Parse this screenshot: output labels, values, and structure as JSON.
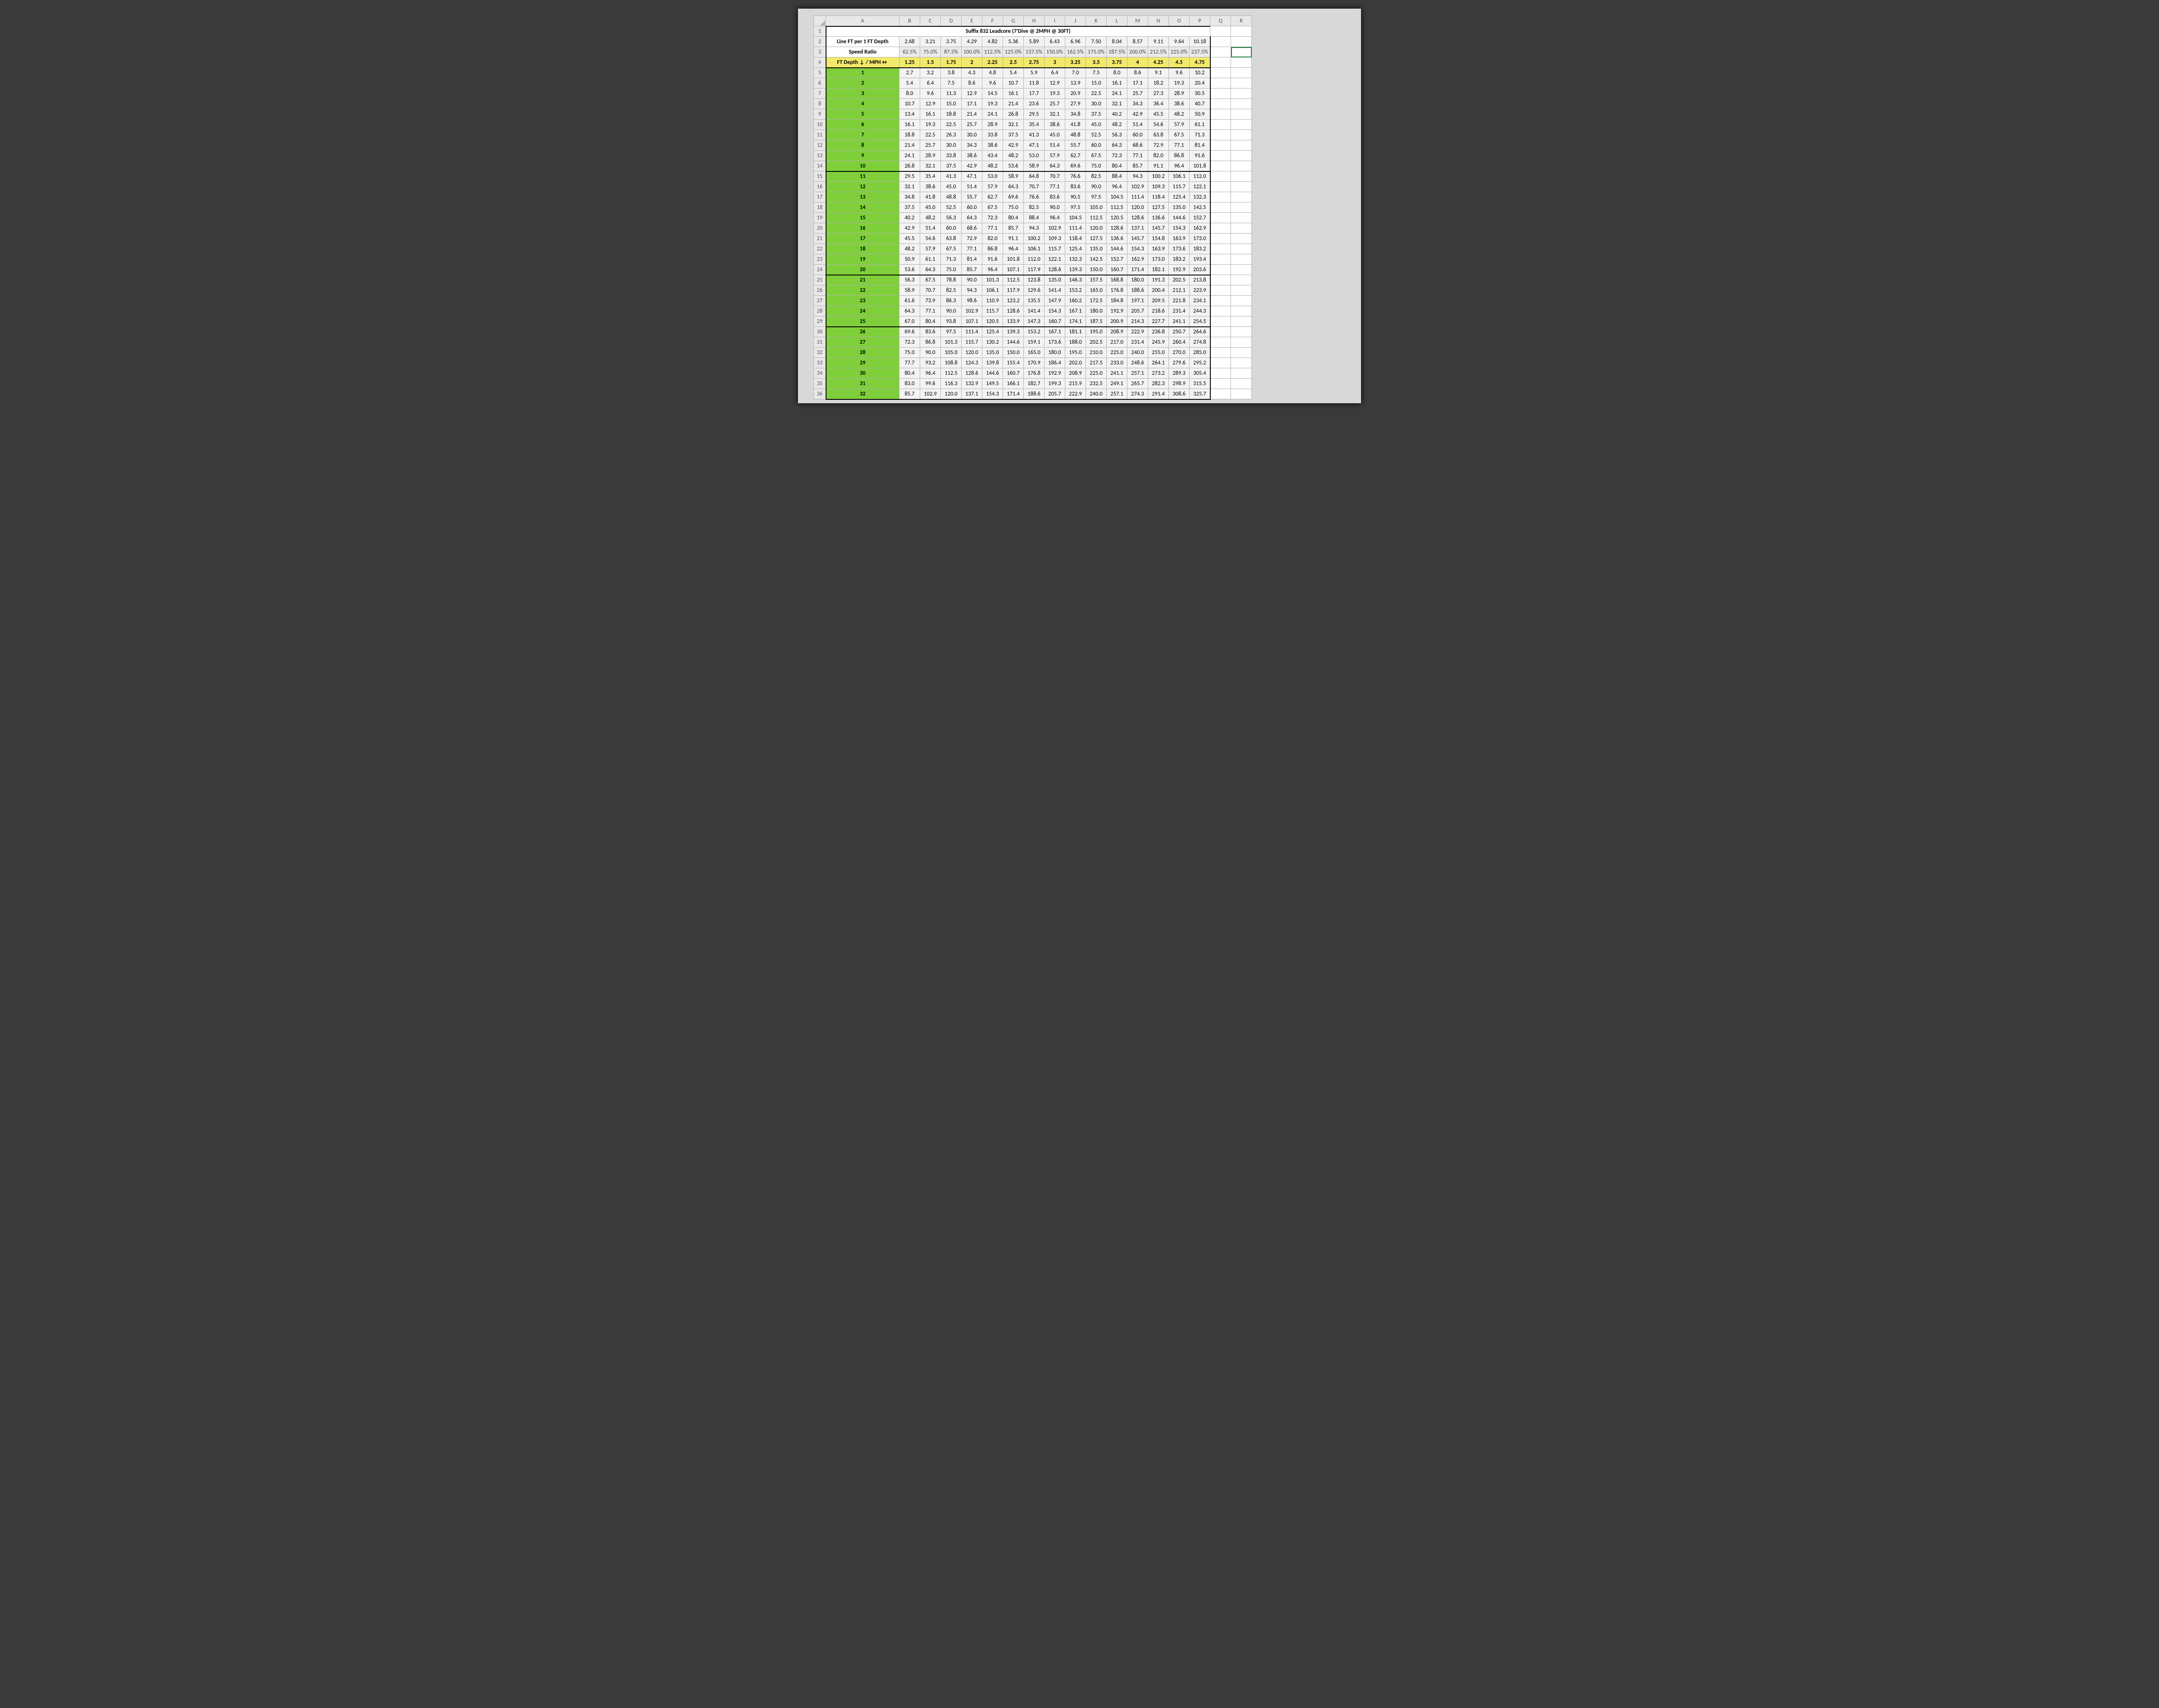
{
  "chart_data": {
    "type": "table",
    "title": "Suffix 832 Leadcore (7'Dive @ 2MPH @ 30FT)",
    "header_labels": {
      "line_ft_per_depth": "Line FT per 1 FT Depth",
      "speed_ratio": "Speed Ratio",
      "depth_mph": "FT Depth ↓ / MPH↔"
    },
    "columns_letters": [
      "A",
      "B",
      "C",
      "D",
      "E",
      "F",
      "G",
      "H",
      "I",
      "J",
      "K",
      "L",
      "M",
      "N",
      "O",
      "P",
      "Q",
      "R"
    ],
    "row_numbers": [
      1,
      2,
      3,
      4,
      5,
      6,
      7,
      8,
      9,
      10,
      11,
      12,
      13,
      14,
      15,
      16,
      17,
      18,
      19,
      20,
      21,
      22,
      23,
      24,
      25,
      26,
      27,
      28,
      29,
      30,
      31,
      32,
      33,
      34,
      35,
      36
    ],
    "line_ft": [
      "2.68",
      "3.21",
      "3.75",
      "4.29",
      "4.82",
      "5.36",
      "5.89",
      "6.43",
      "6.96",
      "7.50",
      "8.04",
      "8.57",
      "9.11",
      "9.64",
      "10.18"
    ],
    "speed_ratio": [
      "62.5%",
      "75.0%",
      "87.5%",
      "100.0%",
      "112.5%",
      "125.0%",
      "137.5%",
      "150.0%",
      "162.5%",
      "175.0%",
      "187.5%",
      "200.0%",
      "212.5%",
      "225.0%",
      "237.5%"
    ],
    "mph": [
      "1.25",
      "1.5",
      "1.75",
      "2",
      "2.25",
      "2.5",
      "2.75",
      "3",
      "3.25",
      "3.5",
      "3.75",
      "4",
      "4.25",
      "4.5",
      "4.75"
    ],
    "depth_labels": [
      "1",
      "2",
      "3",
      "4",
      "5",
      "6",
      "7",
      "8",
      "9",
      "10",
      "11",
      "12",
      "13",
      "14",
      "15",
      "16",
      "17",
      "18",
      "19",
      "20",
      "21",
      "22",
      "23",
      "24",
      "25",
      "26",
      "27",
      "28",
      "29",
      "30",
      "31",
      "32"
    ],
    "values": [
      [
        "2.7",
        "3.2",
        "3.8",
        "4.3",
        "4.8",
        "5.4",
        "5.9",
        "6.4",
        "7.0",
        "7.5",
        "8.0",
        "8.6",
        "9.1",
        "9.6",
        "10.2"
      ],
      [
        "5.4",
        "6.4",
        "7.5",
        "8.6",
        "9.6",
        "10.7",
        "11.8",
        "12.9",
        "13.9",
        "15.0",
        "16.1",
        "17.1",
        "18.2",
        "19.3",
        "20.4"
      ],
      [
        "8.0",
        "9.6",
        "11.3",
        "12.9",
        "14.5",
        "16.1",
        "17.7",
        "19.3",
        "20.9",
        "22.5",
        "24.1",
        "25.7",
        "27.3",
        "28.9",
        "30.5"
      ],
      [
        "10.7",
        "12.9",
        "15.0",
        "17.1",
        "19.3",
        "21.4",
        "23.6",
        "25.7",
        "27.9",
        "30.0",
        "32.1",
        "34.3",
        "36.4",
        "38.6",
        "40.7"
      ],
      [
        "13.4",
        "16.1",
        "18.8",
        "21.4",
        "24.1",
        "26.8",
        "29.5",
        "32.1",
        "34.8",
        "37.5",
        "40.2",
        "42.9",
        "45.5",
        "48.2",
        "50.9"
      ],
      [
        "16.1",
        "19.3",
        "22.5",
        "25.7",
        "28.9",
        "32.1",
        "35.4",
        "38.6",
        "41.8",
        "45.0",
        "48.2",
        "51.4",
        "54.6",
        "57.9",
        "61.1"
      ],
      [
        "18.8",
        "22.5",
        "26.3",
        "30.0",
        "33.8",
        "37.5",
        "41.3",
        "45.0",
        "48.8",
        "52.5",
        "56.3",
        "60.0",
        "63.8",
        "67.5",
        "71.3"
      ],
      [
        "21.4",
        "25.7",
        "30.0",
        "34.3",
        "38.6",
        "42.9",
        "47.1",
        "51.4",
        "55.7",
        "60.0",
        "64.3",
        "68.6",
        "72.9",
        "77.1",
        "81.4"
      ],
      [
        "24.1",
        "28.9",
        "33.8",
        "38.6",
        "43.4",
        "48.2",
        "53.0",
        "57.9",
        "62.7",
        "67.5",
        "72.3",
        "77.1",
        "82.0",
        "86.8",
        "91.6"
      ],
      [
        "26.8",
        "32.1",
        "37.5",
        "42.9",
        "48.2",
        "53.6",
        "58.9",
        "64.3",
        "69.6",
        "75.0",
        "80.4",
        "85.7",
        "91.1",
        "96.4",
        "101.8"
      ],
      [
        "29.5",
        "35.4",
        "41.3",
        "47.1",
        "53.0",
        "58.9",
        "64.8",
        "70.7",
        "76.6",
        "82.5",
        "88.4",
        "94.3",
        "100.2",
        "106.1",
        "112.0"
      ],
      [
        "32.1",
        "38.6",
        "45.0",
        "51.4",
        "57.9",
        "64.3",
        "70.7",
        "77.1",
        "83.6",
        "90.0",
        "96.4",
        "102.9",
        "109.3",
        "115.7",
        "122.1"
      ],
      [
        "34.8",
        "41.8",
        "48.8",
        "55.7",
        "62.7",
        "69.6",
        "76.6",
        "83.6",
        "90.5",
        "97.5",
        "104.5",
        "111.4",
        "118.4",
        "125.4",
        "132.3"
      ],
      [
        "37.5",
        "45.0",
        "52.5",
        "60.0",
        "67.5",
        "75.0",
        "82.5",
        "90.0",
        "97.5",
        "105.0",
        "112.5",
        "120.0",
        "127.5",
        "135.0",
        "142.5"
      ],
      [
        "40.2",
        "48.2",
        "56.3",
        "64.3",
        "72.3",
        "80.4",
        "88.4",
        "96.4",
        "104.5",
        "112.5",
        "120.5",
        "128.6",
        "136.6",
        "144.6",
        "152.7"
      ],
      [
        "42.9",
        "51.4",
        "60.0",
        "68.6",
        "77.1",
        "85.7",
        "94.3",
        "102.9",
        "111.4",
        "120.0",
        "128.6",
        "137.1",
        "145.7",
        "154.3",
        "162.9"
      ],
      [
        "45.5",
        "54.6",
        "63.8",
        "72.9",
        "82.0",
        "91.1",
        "100.2",
        "109.3",
        "118.4",
        "127.5",
        "136.6",
        "145.7",
        "154.8",
        "163.9",
        "173.0"
      ],
      [
        "48.2",
        "57.9",
        "67.5",
        "77.1",
        "86.8",
        "96.4",
        "106.1",
        "115.7",
        "125.4",
        "135.0",
        "144.6",
        "154.3",
        "163.9",
        "173.6",
        "183.2"
      ],
      [
        "50.9",
        "61.1",
        "71.3",
        "81.4",
        "91.6",
        "101.8",
        "112.0",
        "122.1",
        "132.3",
        "142.5",
        "152.7",
        "162.9",
        "173.0",
        "183.2",
        "193.4"
      ],
      [
        "53.6",
        "64.3",
        "75.0",
        "85.7",
        "96.4",
        "107.1",
        "117.9",
        "128.6",
        "139.3",
        "150.0",
        "160.7",
        "171.4",
        "182.1",
        "192.9",
        "203.6"
      ],
      [
        "56.3",
        "67.5",
        "78.8",
        "90.0",
        "101.3",
        "112.5",
        "123.8",
        "135.0",
        "146.3",
        "157.5",
        "168.8",
        "180.0",
        "191.3",
        "202.5",
        "213.8"
      ],
      [
        "58.9",
        "70.7",
        "82.5",
        "94.3",
        "106.1",
        "117.9",
        "129.6",
        "141.4",
        "153.2",
        "165.0",
        "176.8",
        "188.6",
        "200.4",
        "212.1",
        "223.9"
      ],
      [
        "61.6",
        "73.9",
        "86.3",
        "98.6",
        "110.9",
        "123.2",
        "135.5",
        "147.9",
        "160.2",
        "172.5",
        "184.8",
        "197.1",
        "209.5",
        "221.8",
        "234.1"
      ],
      [
        "64.3",
        "77.1",
        "90.0",
        "102.9",
        "115.7",
        "128.6",
        "141.4",
        "154.3",
        "167.1",
        "180.0",
        "192.9",
        "205.7",
        "218.6",
        "231.4",
        "244.3"
      ],
      [
        "67.0",
        "80.4",
        "93.8",
        "107.1",
        "120.5",
        "133.9",
        "147.3",
        "160.7",
        "174.1",
        "187.5",
        "200.9",
        "214.3",
        "227.7",
        "241.1",
        "254.5"
      ],
      [
        "69.6",
        "83.6",
        "97.5",
        "111.4",
        "125.4",
        "139.3",
        "153.2",
        "167.1",
        "181.1",
        "195.0",
        "208.9",
        "222.9",
        "236.8",
        "250.7",
        "264.6"
      ],
      [
        "72.3",
        "86.8",
        "101.3",
        "115.7",
        "130.2",
        "144.6",
        "159.1",
        "173.6",
        "188.0",
        "202.5",
        "217.0",
        "231.4",
        "245.9",
        "260.4",
        "274.8"
      ],
      [
        "75.0",
        "90.0",
        "105.0",
        "120.0",
        "135.0",
        "150.0",
        "165.0",
        "180.0",
        "195.0",
        "210.0",
        "225.0",
        "240.0",
        "255.0",
        "270.0",
        "285.0"
      ],
      [
        "77.7",
        "93.2",
        "108.8",
        "124.3",
        "139.8",
        "155.4",
        "170.9",
        "186.4",
        "202.0",
        "217.5",
        "233.0",
        "248.6",
        "264.1",
        "279.6",
        "295.2"
      ],
      [
        "80.4",
        "96.4",
        "112.5",
        "128.6",
        "144.6",
        "160.7",
        "176.8",
        "192.9",
        "208.9",
        "225.0",
        "241.1",
        "257.1",
        "273.2",
        "289.3",
        "305.4"
      ],
      [
        "83.0",
        "99.6",
        "116.3",
        "132.9",
        "149.5",
        "166.1",
        "182.7",
        "199.3",
        "215.9",
        "232.5",
        "249.1",
        "265.7",
        "282.3",
        "298.9",
        "315.5"
      ],
      [
        "85.7",
        "102.9",
        "120.0",
        "137.1",
        "154.3",
        "171.4",
        "188.6",
        "205.7",
        "222.9",
        "240.0",
        "257.1",
        "274.3",
        "291.4",
        "308.6",
        "325.7"
      ]
    ]
  }
}
